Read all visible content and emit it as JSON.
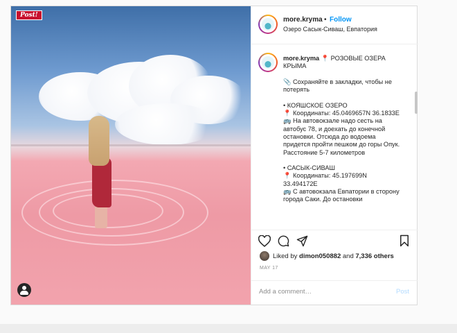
{
  "photo": {
    "badge": "Post!",
    "colors": {
      "sky": "#6f9bd0",
      "lake": "#ef9ca7",
      "dress": "#b0283a"
    }
  },
  "header": {
    "username": "more.kryma",
    "separator": "•",
    "follow": "Follow",
    "location": "Озеро Сасык-Сиваш, Евпатория"
  },
  "caption": {
    "username": "more.kryma",
    "text": "📍 РОЗОВЫЕ ОЗЕРА КРЫМА\n\n📎 Сохраняйте в закладки, чтобы не потерять\n\n• КОЯШСКОЕ ОЗЕРО\n📍 Координаты: 45.0469657N 36.1833E\n🚌 На автовокзале надо сесть на автобус 78, и доехать до конечной остановки. Отсюда до водоема придется пройти пешком до горы Опук. Расстояние 5-7 километров\n\n• САСЫК-СИВАШ\n📍 Координаты: 45.197699N 33.494172E\n🚌 С автовокзала Евпатории в сторону города Саки. До остановки"
  },
  "actions": {
    "like_icon": "heart-icon",
    "comment_icon": "comment-icon",
    "share_icon": "share-icon",
    "save_icon": "bookmark-icon"
  },
  "likes": {
    "prefix": "Liked by",
    "user": "dimon050882",
    "middle": "and",
    "others": "7,336 others"
  },
  "date": "MAY 17",
  "comment": {
    "placeholder": "Add a comment…",
    "post_label": "Post"
  },
  "colors": {
    "link": "#0095f6",
    "muted": "#8e8e8e",
    "border": "#dbdbdb"
  }
}
